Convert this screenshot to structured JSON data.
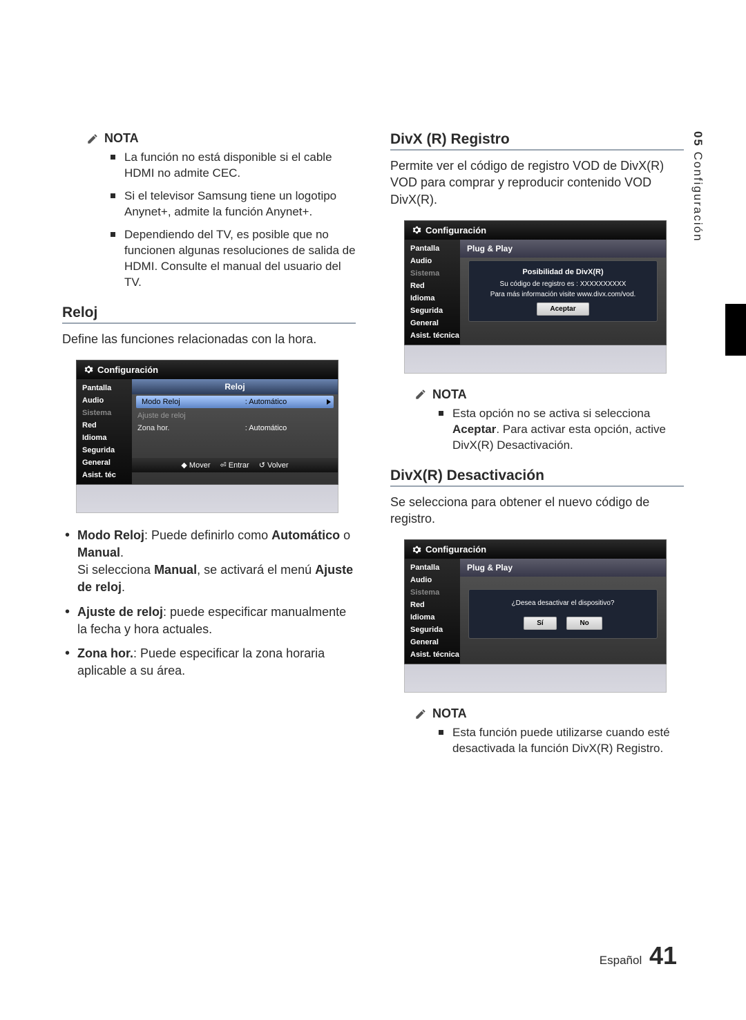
{
  "sideTab": {
    "num": "05",
    "label": "Configuración"
  },
  "notaLabel": "NOTA",
  "leftNotes": [
    "La función no está disponible si el cable HDMI no admite CEC.",
    "Si el televisor Samsung tiene un logotipo Anynet+, admite la función Anynet+.",
    "Dependiendo del TV, es posible que no funcionen algunas resoluciones de salida de HDMI. Consulte el manual del usuario del TV."
  ],
  "relojHeading": "Reloj",
  "relojIntro": "Define las funciones relacionadas con la hora.",
  "osd": {
    "title": "Configuración",
    "menu": [
      "Pantalla",
      "Audio",
      "Sistema",
      "Red",
      "Idioma",
      "Segurida",
      "General",
      "Asist. téc"
    ],
    "menuFull": [
      "Pantalla",
      "Audio",
      "Sistema",
      "Red",
      "Idioma",
      "Segurida",
      "General",
      "Asist. técnica"
    ]
  },
  "relojOsd": {
    "panelHead": "Reloj",
    "rows": [
      {
        "label": "Modo Reloj",
        "val": ": Automático",
        "hi": true
      },
      {
        "label": "Ajuste de reloj",
        "val": "",
        "dim": true
      },
      {
        "label": "Zona hor.",
        "val": ": Automático"
      }
    ],
    "foot": [
      "◆ Mover",
      "⏎ Entrar",
      "↺ Volver"
    ]
  },
  "relojDefs": [
    {
      "term": "Modo Reloj",
      "text1": ": Puede definirlo como ",
      "b1": "Automático",
      "text2": " o ",
      "b2": "Manual",
      "text3": ".",
      "extra": "Si selecciona ",
      "eb1": "Manual",
      "extra2": ", se activará el menú ",
      "eb2": "Ajuste de reloj",
      "extra3": "."
    },
    {
      "term": "Ajuste de reloj",
      "text1": ": puede especificar manualmente la fecha y hora actuales."
    },
    {
      "term": "Zona hor.",
      "text1": ": Puede especificar la zona horaria aplicable a su área."
    }
  ],
  "divxRegHeading": "DivX (R) Registro",
  "divxRegText": "Permite ver el código de registro VOD de DivX(R) VOD para comprar y reproducir contenido VOD DivX(R).",
  "plugPlay": "Plug & Play",
  "divxDialog": {
    "title": "Posibilidad de DivX(R)",
    "line1": "Su código de registro es : XXXXXXXXXX",
    "line2": "Para más información visite www.divx.com/vod.",
    "btn": "Aceptar"
  },
  "divxNote": [
    {
      "text1": "Esta opción no se activa si selecciona ",
      "b": "Aceptar",
      "text2": ". Para activar esta opción, active DivX(R) Desactivación."
    }
  ],
  "divxDeactHeading": "DivX(R) Desactivación",
  "divxDeactText": "Se selecciona para obtener el nuevo código de registro.",
  "deactDialog": {
    "line": "¿Desea desactivar el dispositivo?",
    "yes": "Sí",
    "no": "No"
  },
  "deactNote": "Esta función puede utilizarse cuando esté desactivada la función DivX(R) Registro.",
  "footer": {
    "lang": "Español",
    "num": "41"
  }
}
